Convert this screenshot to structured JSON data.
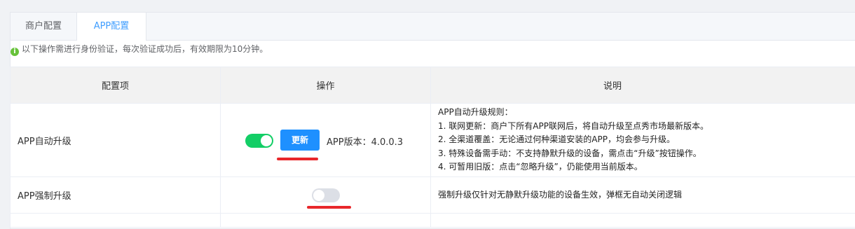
{
  "tabs": [
    {
      "label": "商户配置",
      "active": false
    },
    {
      "label": "APP配置",
      "active": true
    }
  ],
  "notice": {
    "icon": "info-icon",
    "text": "以下操作需进行身份验证，每次验证成功后，有效期限为10分钟。"
  },
  "table": {
    "headers": [
      "配置项",
      "操作",
      "说明"
    ],
    "rows": [
      {
        "label": "APP自动升级",
        "toggle_on": true,
        "button_label": "更新",
        "version_text": "APP版本：4.0.0.3",
        "desc_lines": [
          "APP自动升级规则：",
          "1. 联网更新：商户下所有APP联网后，将自动升级至点秀市场最新版本。",
          "2. 全渠道覆盖：无论通过何种渠道安装的APP，均会参与升级。",
          "3. 特殊设备需手动：不支持静默升级的设备，需点击“升级”按钮操作。",
          "4. 可暂用旧版：点击“忽略升级”，仍能使用当前版本。"
        ]
      },
      {
        "label": "APP强制升级",
        "toggle_on": false,
        "desc": "强制升级仅针对无静默升级功能的设备生效，弹框无自动关闭逻辑"
      }
    ]
  },
  "colors": {
    "accent": "#409eff",
    "switch_on": "#13ce66",
    "annotation": "#e8272b"
  }
}
